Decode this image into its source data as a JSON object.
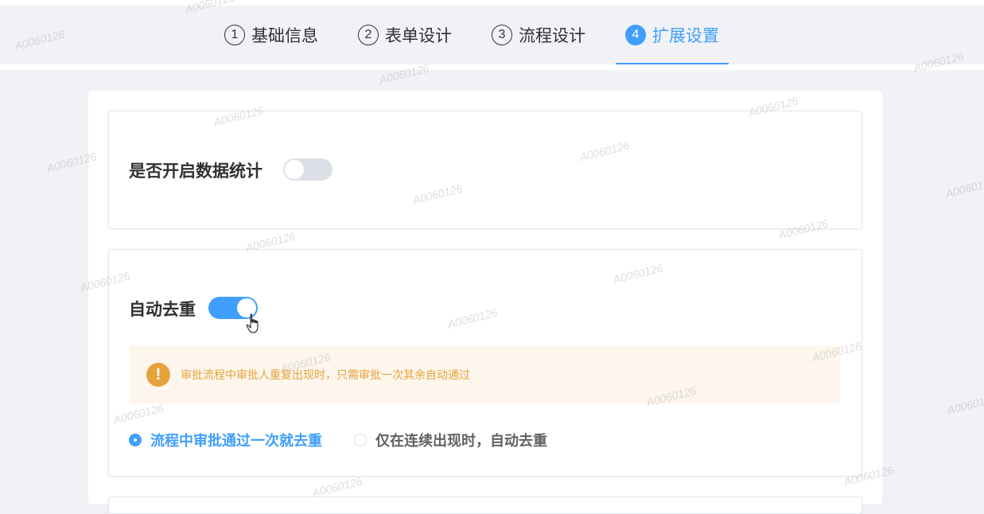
{
  "steps": [
    {
      "num": "1",
      "label": "基础信息"
    },
    {
      "num": "2",
      "label": "表单设计"
    },
    {
      "num": "3",
      "label": "流程设计"
    },
    {
      "num": "4",
      "label": "扩展设置"
    }
  ],
  "active_step": 4,
  "section_stats": {
    "label": "是否开启数据统计",
    "enabled": false
  },
  "section_dedupe": {
    "label": "自动去重",
    "enabled": true,
    "alert": {
      "icon": "warning-icon",
      "glyph": "!",
      "text": "审批流程中审批人重复出现时，只需审批一次其余自动通过"
    },
    "options": [
      {
        "label": "流程中审批通过一次就去重",
        "checked": true
      },
      {
        "label": "仅在连续出现时，自动去重",
        "checked": false
      }
    ]
  },
  "watermark": "A0060126",
  "colors": {
    "primary": "#409eff",
    "warning": "#e6a23c",
    "warning_bg": "#fdf6ec"
  }
}
